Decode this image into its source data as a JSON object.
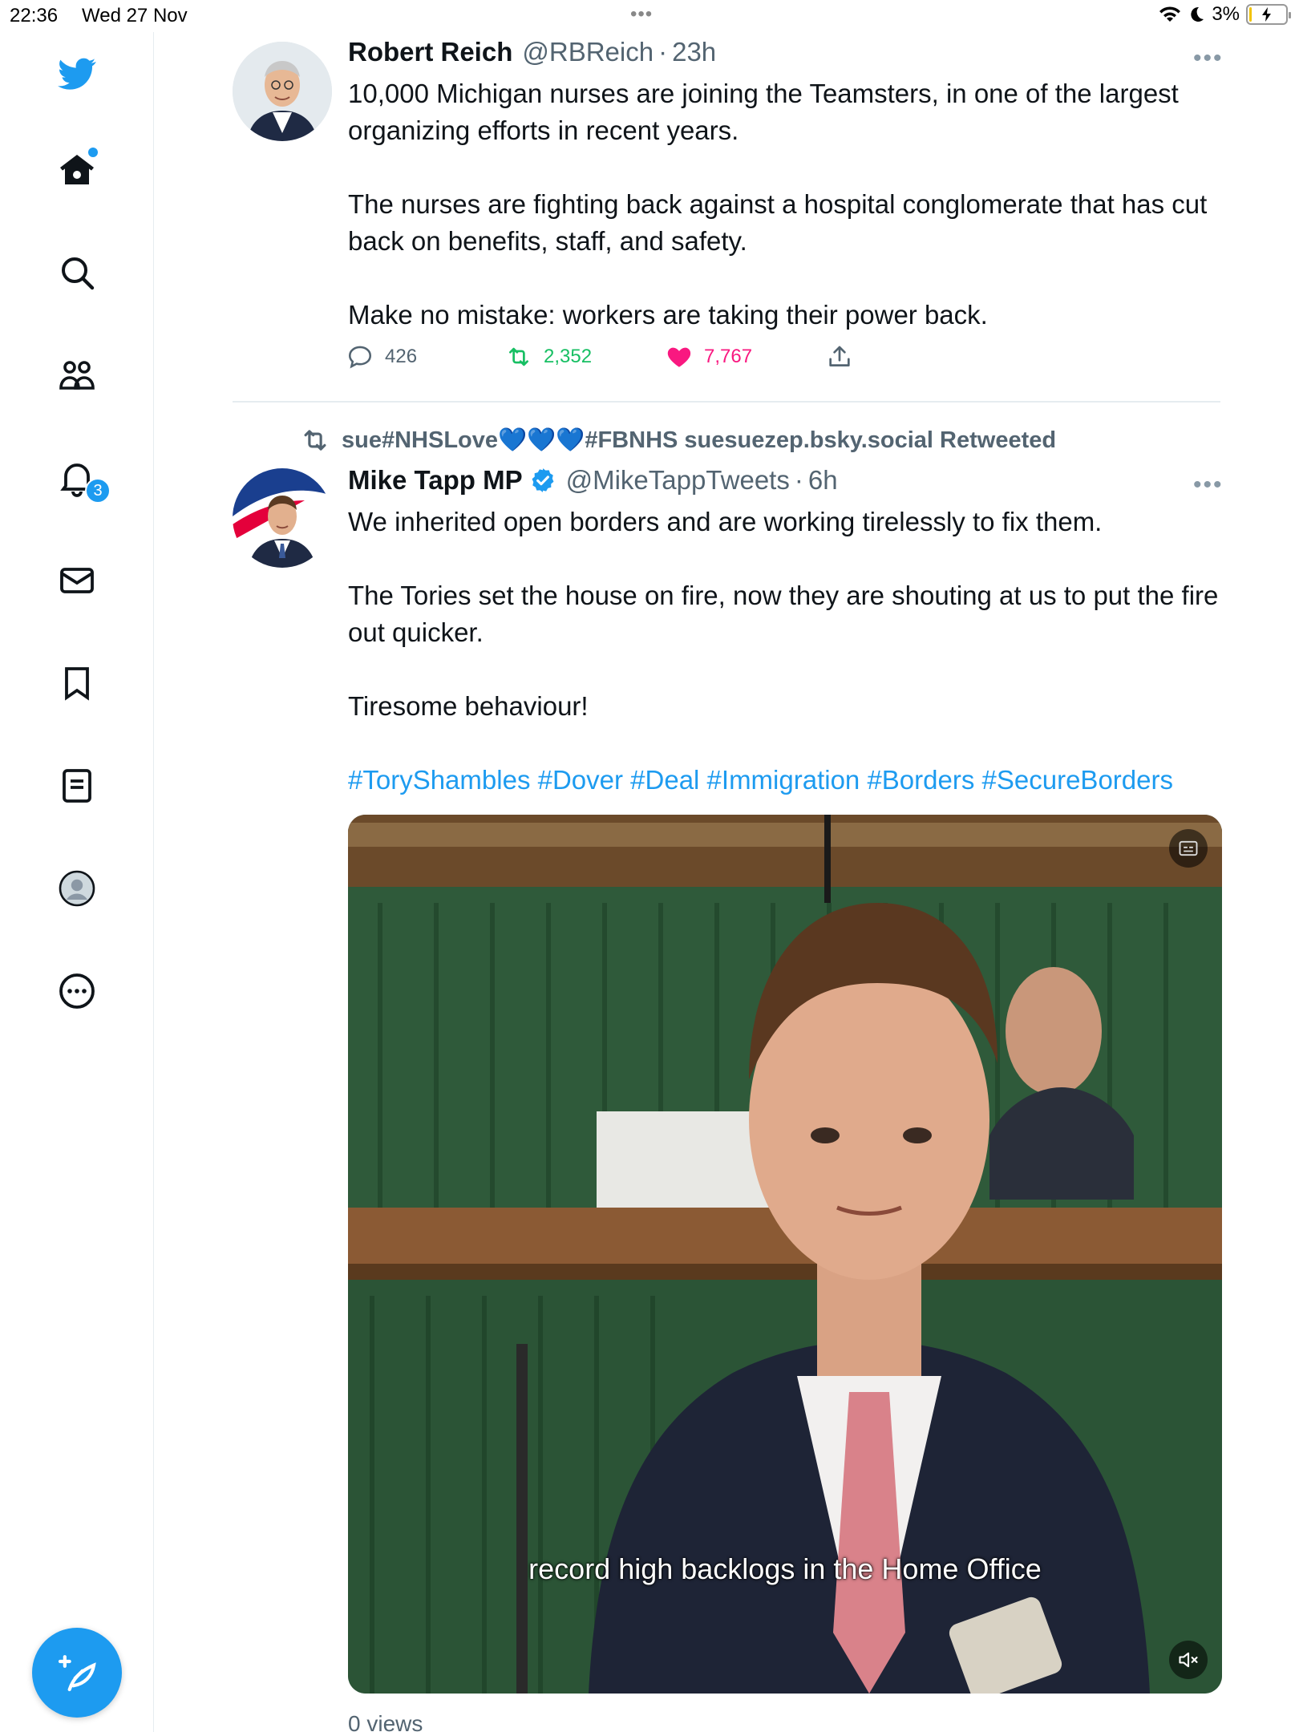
{
  "status_bar": {
    "time": "22:36",
    "date": "Wed 27 Nov",
    "battery": "3%"
  },
  "sidebar": {
    "items": [
      {
        "icon": "twitter-bird-icon"
      },
      {
        "icon": "home-icon"
      },
      {
        "icon": "search-icon"
      },
      {
        "icon": "communities-icon"
      },
      {
        "icon": "notifications-icon",
        "badge": "3"
      },
      {
        "icon": "messages-icon"
      },
      {
        "icon": "bookmarks-icon"
      },
      {
        "icon": "lists-icon"
      },
      {
        "icon": "profile-icon"
      },
      {
        "icon": "more-icon"
      }
    ],
    "compose_icon": "compose-feather-icon",
    "accent": "#1d9bf0"
  },
  "tweet1": {
    "name": "Robert Reich",
    "handle": "@RBReich",
    "time": "23h",
    "paragraphs": [
      "10,000 Michigan nurses are joining the Teamsters, in one of the largest organizing efforts in recent years.",
      "The nurses are fighting back against a hospital conglomerate that has cut back on benefits, staff, and safety.",
      "Make no mistake: workers are taking their power back."
    ],
    "replies": "426",
    "retweets": "2,352",
    "likes": "7,767",
    "retweet_color": "#17bf63",
    "like_color": "#f91880"
  },
  "tweet2": {
    "retweeted_by": "sue#NHSLove💙💙💙#FBNHS suesuezep.bsky.social Retweeted",
    "name": "Mike Tapp MP",
    "handle": "@MikeTappTweets",
    "time": "6h",
    "paragraphs": [
      "We inherited open borders and are working tirelessly to fix them.",
      "The Tories set the house on fire, now they are shouting at us to put the fire out quicker.",
      "Tiresome behaviour!"
    ],
    "hashtags": "#ToryShambles #Dover #Deal #Immigration #Borders #SecureBorders",
    "video_caption": "record high backlogs in the Home Office",
    "views": "0 views"
  }
}
